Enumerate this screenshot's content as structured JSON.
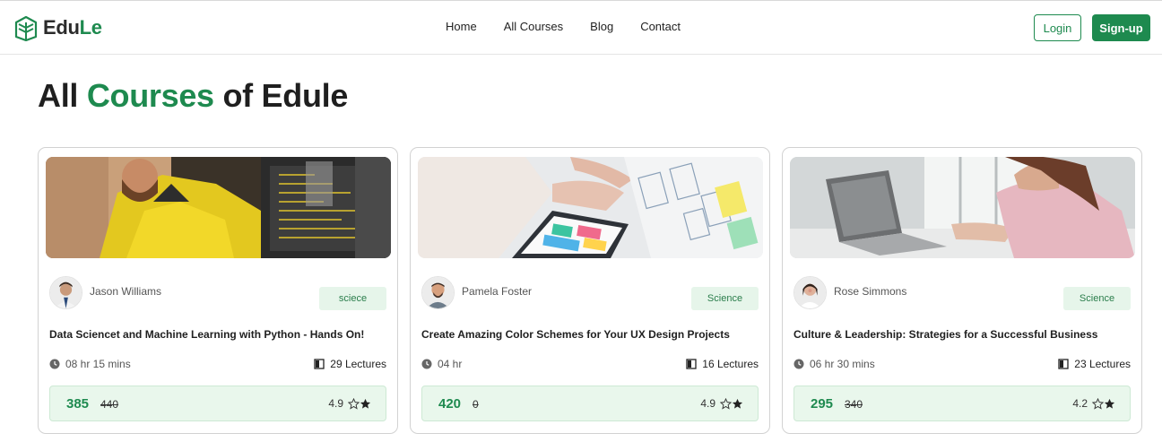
{
  "brand": {
    "name_part1": "Edu",
    "name_part2": "Le",
    "accent": "#1e8a4f"
  },
  "nav": {
    "items": [
      "Home",
      "All Courses",
      "Blog",
      "Contact"
    ]
  },
  "auth": {
    "login_label": "Login",
    "signup_label": "Sign-up"
  },
  "page": {
    "title_part1": "All ",
    "title_part2": "Courses",
    "title_part3": " of Edule"
  },
  "courses": [
    {
      "author": "Jason Williams",
      "category": "sciece",
      "title": "Data Sciencet and Machine Learning with Python - Hands On!",
      "duration": "08 hr 15 mins",
      "lectures": "29 Lectures",
      "price": "385",
      "old_price": "440",
      "rating": "4.9"
    },
    {
      "author": "Pamela Foster",
      "category": "Science",
      "title": "Create Amazing Color Schemes for Your UX Design Projects",
      "duration": "04 hr",
      "lectures": "16 Lectures",
      "price": "420",
      "old_price": "0",
      "rating": "4.9"
    },
    {
      "author": "Rose Simmons",
      "category": "Science",
      "title": "Culture & Leadership: Strategies for a Successful Business",
      "duration": "06 hr 30 mins",
      "lectures": "23 Lectures",
      "price": "295",
      "old_price": "340",
      "rating": "4.2"
    }
  ]
}
